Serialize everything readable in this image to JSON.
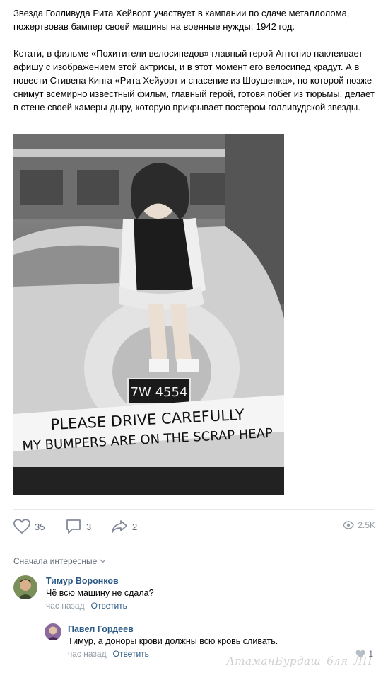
{
  "post": {
    "paragraph1": "Звезда Голливуда Рита Хейворт участвует в кампании по сдаче металлолома, пожертвовав бампер своей машины на военные нужды, 1942 год.",
    "paragraph2": "Кстати, в фильме «Похитители велосипедов» главный герой Антонио наклеивает афишу с изображением этой актрисы, и в этот момент его велосипед крадут. А в повести Стивена Кинга «Рита Хейуорт и спасение из Шоушенка», по которой позже снимут всемирно известный фильм, главный герой, готовя побег из тюрьмы, делает в стене своей камеры дыру, которую прикрывает постером голливудской звезды."
  },
  "photo": {
    "sign_line1": "PLEASE DRIVE CAREFULLY",
    "sign_line2": "MY BUMPERS ARE ON THE SCRAP HEAP",
    "plate": "7W 4554"
  },
  "actions": {
    "likes": "35",
    "comments": "3",
    "shares": "2",
    "views": "2.5K",
    "like_icon": "heart-icon",
    "comment_icon": "comment-icon",
    "share_icon": "share-icon",
    "views_icon": "eye-icon"
  },
  "comments_section": {
    "sort_label": "Сначала интересные"
  },
  "comments": [
    {
      "author": "Тимур Воронков",
      "text": "Чё всю машину не сдала?",
      "time": "час назад",
      "reply_label": "Ответить"
    },
    {
      "author": "Павел Гордеев",
      "text": "Тимур, а доноры крови должны всю кровь сливать.",
      "time": "час назад",
      "reply_label": "Ответить",
      "likes": "1"
    }
  ],
  "watermark": "АтаманБурдаш_бля_ЛП",
  "colors": {
    "link": "#2a5885",
    "muted": "#939ca6",
    "icon": "#828a99",
    "divider": "#e7e8ec"
  }
}
